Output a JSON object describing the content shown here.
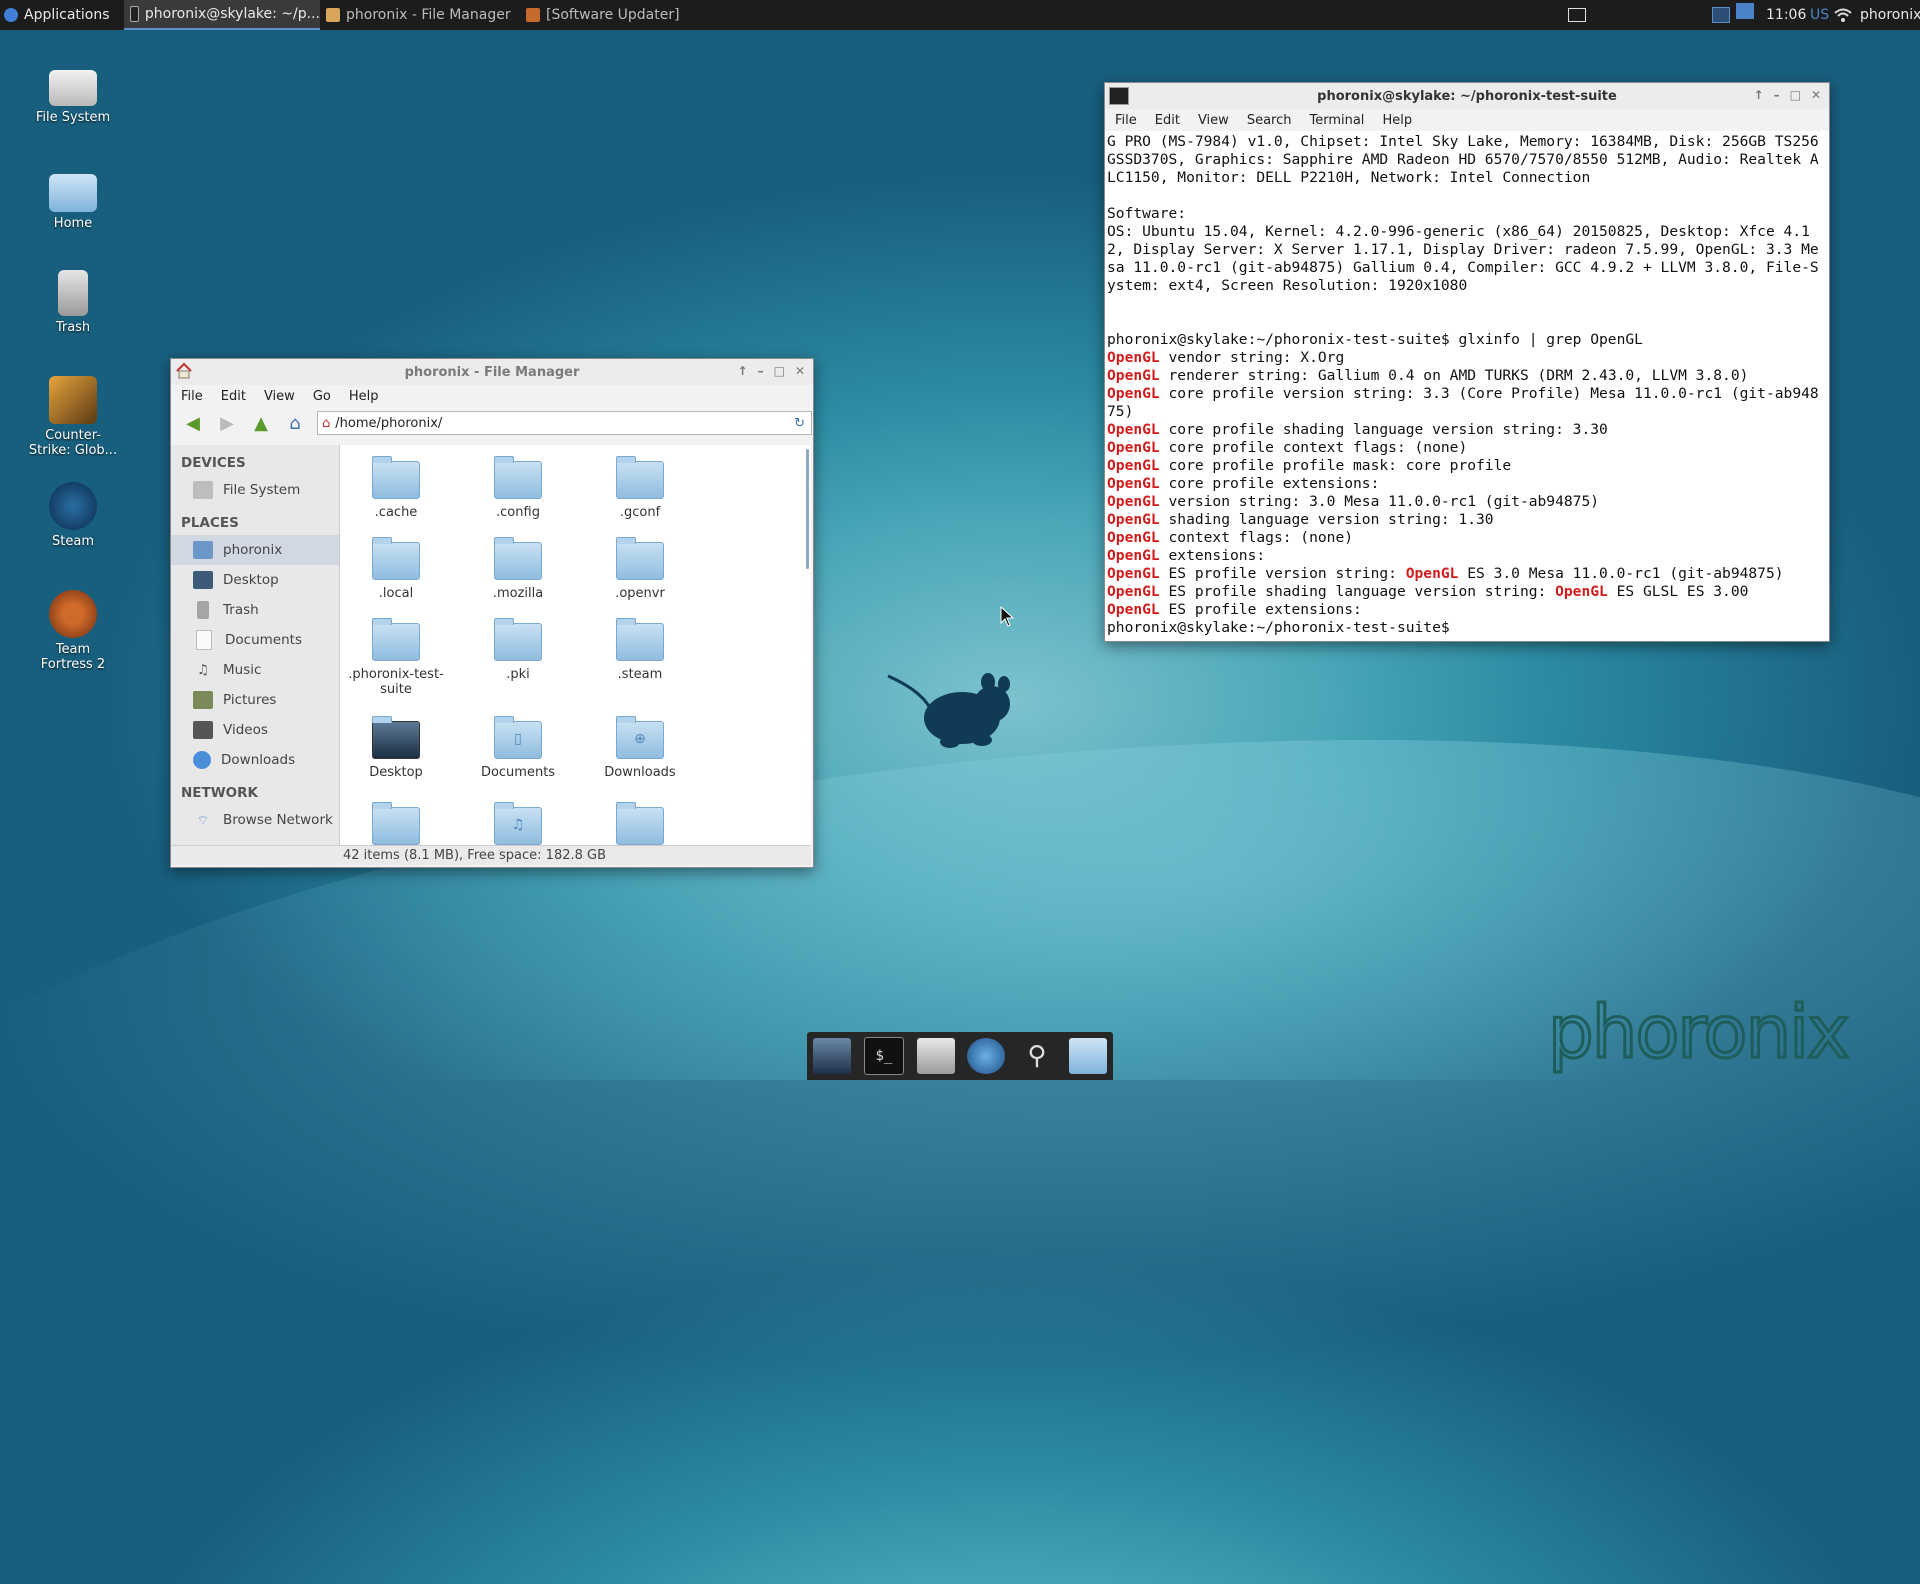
{
  "top_panel": {
    "applications_label": "Applications",
    "tasks": [
      "phoronix@skylake: ~/p...",
      "phoronix - File Manager",
      "[Software Updater]"
    ],
    "clock": "11:06",
    "keyboard_layout": "US",
    "user": "phoronix"
  },
  "desktop_icons": [
    {
      "label": "File System"
    },
    {
      "label": "Home"
    },
    {
      "label": "Trash"
    },
    {
      "label": "Counter-Strike: Glob..."
    },
    {
      "label": "Steam"
    },
    {
      "label": "Team Fortress 2"
    }
  ],
  "file_manager": {
    "title": "phoronix - File Manager",
    "menu": [
      "File",
      "Edit",
      "View",
      "Go",
      "Help"
    ],
    "location": "/home/phoronix/",
    "sidebar": {
      "devices_heading": "DEVICES",
      "devices": [
        "File System"
      ],
      "places_heading": "PLACES",
      "places": [
        "phoronix",
        "Desktop",
        "Trash",
        "Documents",
        "Music",
        "Pictures",
        "Videos",
        "Downloads"
      ],
      "network_heading": "NETWORK",
      "network": [
        "Browse Network"
      ]
    },
    "items": [
      ".cache",
      ".config",
      ".gconf",
      ".local",
      ".mozilla",
      ".openvr",
      ".phoronix-test-suite",
      ".pki",
      ".steam",
      "Desktop",
      "Documents",
      "Downloads",
      "",
      "",
      ""
    ],
    "status": "42 items (8.1 MB), Free space: 182.8 GB"
  },
  "terminal": {
    "title": "phoronix@skylake: ~/phoronix-test-suite",
    "menu": [
      "File",
      "Edit",
      "View",
      "Search",
      "Terminal",
      "Help"
    ],
    "lines": [
      {
        "plain": "G PRO (MS-7984) v1.0, Chipset: Intel Sky Lake, Memory: 16384MB, Disk: 256GB TS256GSSD370S, Graphics: Sapphire AMD Radeon HD 6570/7570/8550 512MB, Audio: Realtek ALC1150, Monitor: DELL P2210H, Network: Intel Connection"
      },
      {
        "plain": ""
      },
      {
        "plain": "Software:"
      },
      {
        "plain": "OS: Ubuntu 15.04, Kernel: 4.2.0-996-generic (x86_64) 20150825, Desktop: Xfce 4.12, Display Server: X Server 1.17.1, Display Driver: radeon 7.5.99, OpenGL: 3.3 Mesa 11.0.0-rc1 (git-ab94875) Gallium 0.4, Compiler: GCC 4.9.2 + LLVM 3.8.0, File-System: ext4, Screen Resolution: 1920x1080"
      },
      {
        "plain": ""
      },
      {
        "plain": ""
      },
      {
        "plain": "phoronix@skylake:~/phoronix-test-suite$ glxinfo | grep OpenGL"
      },
      {
        "gl": "OpenGL",
        "rest": " vendor string: X.Org"
      },
      {
        "gl": "OpenGL",
        "rest": " renderer string: Gallium 0.4 on AMD TURKS (DRM 2.43.0, LLVM 3.8.0)"
      },
      {
        "gl": "OpenGL",
        "rest": " core profile version string: 3.3 (Core Profile) Mesa 11.0.0-rc1 (git-ab94875)"
      },
      {
        "gl": "OpenGL",
        "rest": " core profile shading language version string: 3.30"
      },
      {
        "gl": "OpenGL",
        "rest": " core profile context flags: (none)"
      },
      {
        "gl": "OpenGL",
        "rest": " core profile profile mask: core profile"
      },
      {
        "gl": "OpenGL",
        "rest": " core profile extensions:"
      },
      {
        "gl": "OpenGL",
        "rest": " version string: 3.0 Mesa 11.0.0-rc1 (git-ab94875)"
      },
      {
        "gl": "OpenGL",
        "rest": " shading language version string: 1.30"
      },
      {
        "gl": "OpenGL",
        "rest": " context flags: (none)"
      },
      {
        "gl": "OpenGL",
        "rest": " extensions:"
      },
      {
        "gl": "OpenGL",
        "rest": " ES profile version string: ",
        "gl2": "OpenGL",
        "rest2": " ES 3.0 Mesa 11.0.0-rc1 (git-ab94875)"
      },
      {
        "gl": "OpenGL",
        "rest": " ES profile shading language version string: ",
        "gl2": "OpenGL",
        "rest2": " ES GLSL ES 3.00"
      },
      {
        "gl": "OpenGL",
        "rest": " ES profile extensions:"
      },
      {
        "plain": "phoronix@skylake:~/phoronix-test-suite$"
      }
    ]
  },
  "dock": [
    "screen-icon",
    "terminal-icon",
    "home-folder-icon",
    "web-browser-icon",
    "search-icon",
    "file-manager-icon"
  ],
  "watermark": "phoronix",
  "colors": {
    "panel": "#1c1c1c",
    "opengl_red": "#d21b1b",
    "accent": "#5a8fc8"
  }
}
